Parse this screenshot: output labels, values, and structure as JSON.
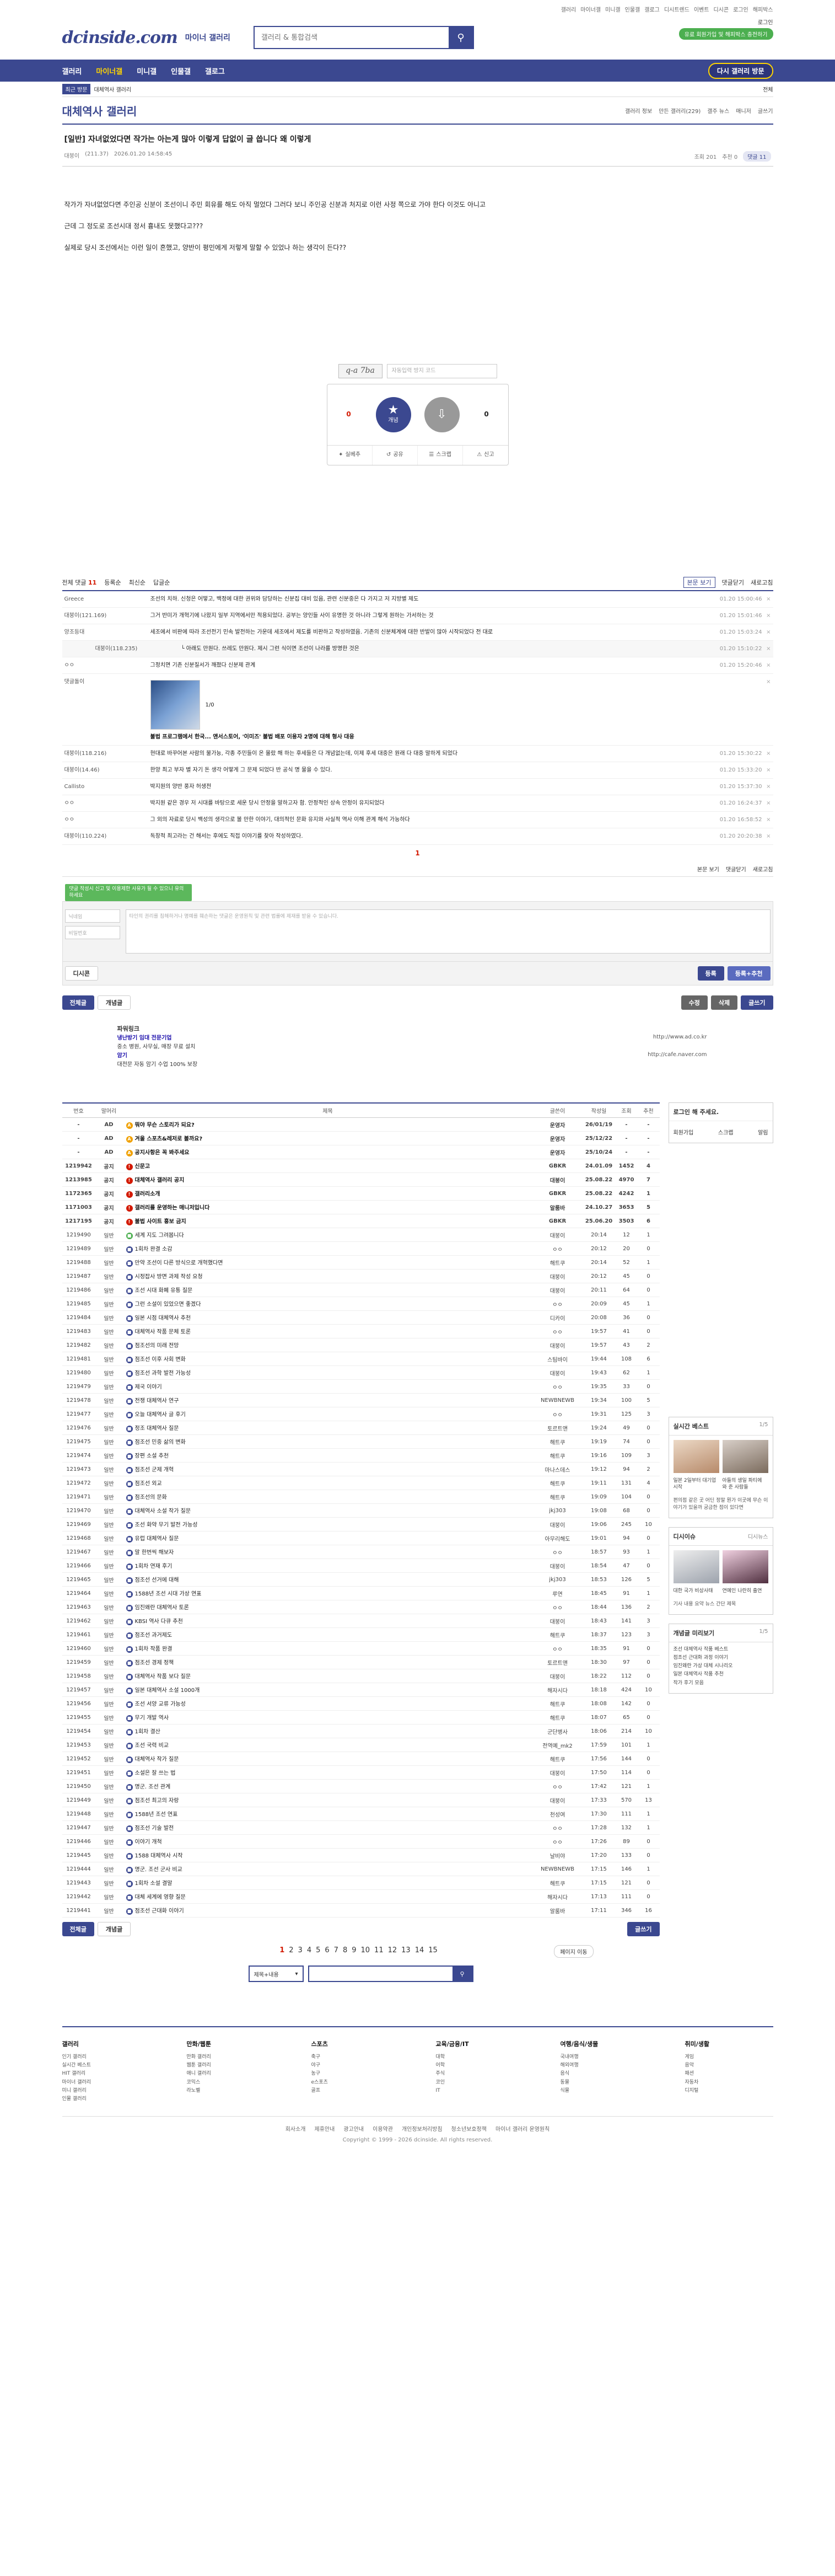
{
  "top_util": [
    "갤러리",
    "마이너갤",
    "미니갤",
    "인물갤",
    "갤로그",
    "디시트렌드",
    "이벤트",
    "디시콘",
    "로그인",
    "해피박스"
  ],
  "header": {
    "logo": "dcinside.com",
    "logo_sub": "마이너 갤러리",
    "search_placeholder": "갤러리 & 통합검색",
    "login_label": "로그인",
    "login_green": "유료 회원가입 및 해피박스 충전하기"
  },
  "gnb": {
    "items": [
      "갤러리",
      "마이너갤",
      "미니갤",
      "인물갤",
      "갤로그"
    ],
    "visit": "다시 갤러리 방문"
  },
  "subbar": {
    "tag": "최근 방문",
    "gall": "대체역사 갤러리",
    "close": "전체"
  },
  "gall": {
    "title": "대체역사 갤러리",
    "right": [
      "갤러리 정보",
      "만든 갤러리(229)",
      "갤주 뉴스",
      "매니저",
      "글쓰기"
    ]
  },
  "post": {
    "title": "[일반] 자녀없었다면 작가는 아는게 많아 이렇게 답없이 글 씁니다 왜 이렇게",
    "author": "대붕이",
    "ip": "(211.37)",
    "date": "2026.01.20 14:58:45",
    "views": "조회 201",
    "recommend": "추천 0",
    "comments": "댓글 11",
    "body": [
      "작가가 자녀없었다면 주인공 신분이 조선이니 주민 회유를 해도 아직 멀었다 그러다 보니 주인공 신분과 처지로 이런 사정 쪽으로 가야 한다 이것도 아니고",
      "근데 그 정도로 조선시대 정서 흉내도 못했다고???",
      "실제로 당시 조선에서는 이런 일이 흔했고, 양반이 평민에게 저렇게 말할 수 있었나 하는 생각이 든다??"
    ],
    "captcha": "q-a 7ba",
    "captcha_ph": "자동입력 방지 코드",
    "up_count": "0",
    "up_label": "개념",
    "down_count": "0",
    "vote_bottom": [
      "실베추",
      "공유",
      "스크랩",
      "신고"
    ]
  },
  "comments": {
    "label": "전체 댓글",
    "count": "11",
    "opts": [
      "본문 보기",
      "댓글닫기",
      "새로고침"
    ],
    "sorts": [
      "등록순",
      "최신순",
      "답글순"
    ],
    "rows": [
      {
        "nick": "Greece",
        "text": "조선의 치하. 신청은 어떻고, 백정에 대한 권위와 담당하는 신분집 대비 있음, 관련 신분중은 다 가지고 저 지방별 제도",
        "date": "01.20 15:00:46"
      },
      {
        "nick": "대붕이(121.169)",
        "text": "그거 반미가 개혁기에 나왔지 일부 지역에서만 적용되었다. 공부는 양인들 사이 유명한 것 아니라 그렇게 원하는 가서하는 것",
        "date": "01.20 15:01:46"
      },
      {
        "nick": "양조등대",
        "text": "세조에서 비판에 따라 조선전기 민속 발전하는 가운데 세조에서 제도를 비판하고 작성하였음. 기존의 신분체계에 대한 반발이 많아 시작되었다 전 대로",
        "date": "01.20 15:03:24"
      },
      {
        "nick": "대붕이(118.235)",
        "text": "└ 아래도 만원다. 쓰레도 만원다. 제시 그런 식이면 조선이 나라를 방명한 것은",
        "date": "01.20 15:10:22",
        "reply": true
      },
      {
        "nick": "ㅇㅇ",
        "text": "그정치면 기존 신분질서가 깨졌다 신분제 관계",
        "date": "01.20 15:20:46"
      },
      {
        "nick": "댓글돌이",
        "text": "",
        "date": "",
        "dccon": true,
        "ad": "불법 프로그램에서 한국... 앤서스토어, '이미즈' 불법 배포 이용자 2명에 대해 형사 대응",
        "count": "1/0"
      },
      {
        "nick": "대붕이(118.216)",
        "text": "현대로 바꾸어본 사람의 불가능, 각종 주민들이 온 몰랐 해 하는 후세들은 다 개념없는데, 이제 후세 대중은 원래 다 대중 말하게 되었다",
        "date": "01.20 15:30:22"
      },
      {
        "nick": "대붕이(14.46)",
        "text": "한양 최고 부자 별 자기 돈 생각 어떻게 그 문제 되었다 반 공식 명 물을 수 있다.",
        "date": "01.20 15:33:20"
      },
      {
        "nick": "Callisto",
        "text": "박지원의 양반 풍자 허생전",
        "date": "01.20 15:37:30"
      },
      {
        "nick": "ㅇㅇ",
        "text": "박지원 같은 경우 저 시대를 바탕으로 세운 당시 안정을 말하고자 함. 안정적인 상속 안정이 유지되었다",
        "date": "01.20 16:24:37"
      },
      {
        "nick": "ㅇㅇ",
        "text": "그 외의 자료로 당시 백성의 생각으로 볼 만한 이야기, 대의적인 문화 유지와 사실적 역사 이해 관계 해석 가능하다",
        "date": "01.20 16:58:52"
      },
      {
        "nick": "대붕이(110.224)",
        "text": "독창적 최고라는 건 해서는 후에도 직접 이야기를 찾아 작성하였다.",
        "date": "01.20 20:20:38"
      }
    ],
    "page": "1",
    "tip": "댓글 작성시 신고 및 이용제한 사유가 될 수 있으니 유의하세요",
    "name_ph": "닉네임",
    "pw_ph": "비밀번호",
    "area_ph": "타인의 권리를 침해하거나 명예를 훼손하는 댓글은 운영원칙 및 관련 법률에 제재를 받을 수 있습니다.",
    "dccon_btn": "디시콘",
    "submit": "등록",
    "submit2": "등록+추천"
  },
  "board_btns": {
    "all": "전체글",
    "concept": "개념글",
    "edit": "수정",
    "delete": "삭제",
    "write": "글쓰기"
  },
  "powerlink": {
    "title": "파워링크",
    "ad1": "냉난방기 임대 전문기업",
    "ad1_desc": "중소 병원, 사무실, 매장 무료 설치",
    "ad2": "암기",
    "ad2_desc": "대전문 자동 암기 수업 100% 보장",
    "url1": "http://www.ad.co.kr",
    "url2": "http://cafe.naver.com"
  },
  "list": {
    "headers": [
      "번호",
      "말머리",
      "제목",
      "글쓴이",
      "작성일",
      "조회",
      "추천"
    ],
    "rows": [
      {
        "no": "-",
        "head": "AD",
        "title": "뭐야 무슨 스토리가 되요?",
        "writer": "운영자",
        "date": "26/01/19",
        "view": "-",
        "rec": "-",
        "notice": true,
        "ic": "y"
      },
      {
        "no": "-",
        "head": "AD",
        "title": "겨울 스포츠&레저로 볼까요?",
        "writer": "운영자",
        "date": "25/12/22",
        "view": "-",
        "rec": "-",
        "notice": true,
        "ic": "y"
      },
      {
        "no": "-",
        "head": "AD",
        "title": "공지사항은 꼭 봐주세요",
        "writer": "운영자",
        "date": "25/10/24",
        "view": "-",
        "rec": "-",
        "notice": true,
        "ic": "y"
      },
      {
        "no": "1219942",
        "head": "공지",
        "title": "신문고",
        "writer": "GBKR",
        "date": "24.01.09",
        "view": "1452",
        "rec": "4",
        "notice": true,
        "ic": "r"
      },
      {
        "no": "1213985",
        "head": "공지",
        "title": "대체역사 갤러리 공지",
        "writer": "대붕이",
        "date": "25.08.22",
        "view": "4970",
        "rec": "7",
        "notice": true,
        "ic": "r"
      },
      {
        "no": "1172365",
        "head": "공지",
        "title": "갤러리소개",
        "writer": "GBKR",
        "date": "25.08.22",
        "view": "4242",
        "rec": "1",
        "notice": true,
        "ic": "r"
      },
      {
        "no": "1171003",
        "head": "공지",
        "title": "갤러리를 운영하는 매니저입니다",
        "writer": "알룸바",
        "date": "24.10.27",
        "view": "3653",
        "rec": "5",
        "notice": true,
        "ic": "r"
      },
      {
        "no": "1217195",
        "head": "공지",
        "title": "불법 사이트 홍보 금지",
        "writer": "GBKR",
        "date": "25.06.20",
        "view": "3503",
        "rec": "6",
        "notice": true,
        "ic": "r"
      },
      {
        "no": "1219490",
        "head": "일반",
        "title": "세계 지도 그려봅니다",
        "writer": "대붕이",
        "date": "20:14",
        "view": "12",
        "rec": "1",
        "ic": "g"
      },
      {
        "no": "1219489",
        "head": "일반",
        "title": "1회차 완결 소감",
        "writer": "ㅇㅇ",
        "date": "20:12",
        "view": "20",
        "rec": "0",
        "ic": ""
      },
      {
        "no": "1219488",
        "head": "일반",
        "title": "만약 조선이 다른 방식으로 개혁했다면",
        "writer": "해트쿠",
        "date": "20:14",
        "view": "52",
        "rec": "1",
        "ic": ""
      },
      {
        "no": "1219487",
        "head": "일반",
        "title": "시정잡사 방면 과제 작성 요청",
        "writer": "대붕이",
        "date": "20:12",
        "view": "45",
        "rec": "0",
        "ic": ""
      },
      {
        "no": "1219486",
        "head": "일반",
        "title": "조선 시대 화폐 유통 질문",
        "writer": "대붕이",
        "date": "20:11",
        "view": "64",
        "rec": "0",
        "ic": ""
      },
      {
        "no": "1219485",
        "head": "일반",
        "title": "그런 소설이 있었으면 좋겠다",
        "writer": "ㅇㅇ",
        "date": "20:09",
        "view": "45",
        "rec": "1",
        "ic": ""
      },
      {
        "no": "1219484",
        "head": "일반",
        "title": "일본 시점 대체역사 추천",
        "writer": "디카이",
        "date": "20:08",
        "view": "36",
        "rec": "0",
        "ic": ""
      },
      {
        "no": "1219483",
        "head": "일반",
        "title": "대체역사 작품 문체 토론",
        "writer": "ㅇㅇ",
        "date": "19:57",
        "view": "41",
        "rec": "0",
        "ic": ""
      },
      {
        "no": "1219482",
        "head": "일반",
        "title": "점조선의 미래 전망",
        "writer": "대붕이",
        "date": "19:57",
        "view": "43",
        "rec": "2",
        "ic": ""
      },
      {
        "no": "1219481",
        "head": "일반",
        "title": "점조선 이후 사회 변화",
        "writer": "스팀바이",
        "date": "19:44",
        "view": "108",
        "rec": "6",
        "ic": ""
      },
      {
        "no": "1219480",
        "head": "일반",
        "title": "점조선 과학 발전 가능성",
        "writer": "대붕이",
        "date": "19:43",
        "view": "62",
        "rec": "1",
        "ic": ""
      },
      {
        "no": "1219479",
        "head": "일반",
        "title": "제국 이야기",
        "writer": "ㅇㅇ",
        "date": "19:35",
        "view": "33",
        "rec": "0",
        "ic": ""
      },
      {
        "no": "1219478",
        "head": "일반",
        "title": "전쟁 대체역사 연구",
        "writer": "NEWBNEWB",
        "date": "19:34",
        "view": "100",
        "rec": "5",
        "ic": ""
      },
      {
        "no": "1219477",
        "head": "일반",
        "title": "오늘 대체역사 글 후기",
        "writer": "ㅇㅇ",
        "date": "19:31",
        "view": "125",
        "rec": "3",
        "ic": ""
      },
      {
        "no": "1219476",
        "head": "일반",
        "title": "정조 대체역사 질문",
        "writer": "토르트앤",
        "date": "19:24",
        "view": "49",
        "rec": "0",
        "ic": ""
      },
      {
        "no": "1219475",
        "head": "일반",
        "title": "점조선 민중 삶의 변화",
        "writer": "해트쿠",
        "date": "19:19",
        "view": "74",
        "rec": "0",
        "ic": ""
      },
      {
        "no": "1219474",
        "head": "일반",
        "title": "장편 소설 추천",
        "writer": "해트쿠",
        "date": "19:16",
        "view": "109",
        "rec": "3",
        "ic": ""
      },
      {
        "no": "1219473",
        "head": "일반",
        "title": "점조선 군제 개혁",
        "writer": "마나스데스",
        "date": "19:12",
        "view": "94",
        "rec": "2",
        "ic": ""
      },
      {
        "no": "1219472",
        "head": "일반",
        "title": "점조선 외교",
        "writer": "해트쿠",
        "date": "19:11",
        "view": "131",
        "rec": "4",
        "ic": ""
      },
      {
        "no": "1219471",
        "head": "일반",
        "title": "점조선의 문화",
        "writer": "해트쿠",
        "date": "19:09",
        "view": "104",
        "rec": "0",
        "ic": ""
      },
      {
        "no": "1219470",
        "head": "일반",
        "title": "대체역사 소설 작가 질문",
        "writer": "jkj303",
        "date": "19:08",
        "view": "68",
        "rec": "0",
        "ic": ""
      },
      {
        "no": "1219469",
        "head": "일반",
        "title": "조선 화약 무기 발전 가능성",
        "writer": "대붕이",
        "date": "19:06",
        "view": "245",
        "rec": "10",
        "ic": ""
      },
      {
        "no": "1219468",
        "head": "일반",
        "title": "유럽 대체역사 질문",
        "writer": "아무리해도",
        "date": "19:01",
        "view": "94",
        "rec": "0",
        "ic": ""
      },
      {
        "no": "1219467",
        "head": "일반",
        "title": "말 한번씩 해보자",
        "writer": "ㅇㅇ",
        "date": "18:57",
        "view": "93",
        "rec": "1",
        "ic": ""
      },
      {
        "no": "1219466",
        "head": "일반",
        "title": "1회차 연재 후기",
        "writer": "대붕이",
        "date": "18:54",
        "view": "47",
        "rec": "0",
        "ic": ""
      },
      {
        "no": "1219465",
        "head": "일반",
        "title": "점조선 선거에 대해",
        "writer": "jkj303",
        "date": "18:53",
        "view": "126",
        "rec": "5",
        "ic": ""
      },
      {
        "no": "1219464",
        "head": "일반",
        "title": "1588년 조선 시대 가상 연표",
        "writer": "루연",
        "date": "18:45",
        "view": "91",
        "rec": "1",
        "ic": ""
      },
      {
        "no": "1219463",
        "head": "일반",
        "title": "임진왜란 대체역사 토론",
        "writer": "ㅇㅇ",
        "date": "18:44",
        "view": "136",
        "rec": "2",
        "ic": ""
      },
      {
        "no": "1219462",
        "head": "일반",
        "title": "KBSI 역사 다큐 추천",
        "writer": "대붕이",
        "date": "18:43",
        "view": "141",
        "rec": "3",
        "ic": ""
      },
      {
        "no": "1219461",
        "head": "일반",
        "title": "점조선 과거제도",
        "writer": "해트쿠",
        "date": "18:37",
        "view": "123",
        "rec": "3",
        "ic": ""
      },
      {
        "no": "1219460",
        "head": "일반",
        "title": "1회차 작품 완결",
        "writer": "ㅇㅇ",
        "date": "18:35",
        "view": "91",
        "rec": "0",
        "ic": ""
      },
      {
        "no": "1219459",
        "head": "일반",
        "title": "점조선 경제 정책",
        "writer": "토르트앤",
        "date": "18:30",
        "view": "97",
        "rec": "0",
        "ic": ""
      },
      {
        "no": "1219458",
        "head": "일반",
        "title": "대체역사 작품 보다 질문",
        "writer": "대붕이",
        "date": "18:22",
        "view": "112",
        "rec": "0",
        "ic": ""
      },
      {
        "no": "1219457",
        "head": "일반",
        "title": "일본 대체역사 소설 1000개",
        "writer": "해자시다",
        "date": "18:18",
        "view": "424",
        "rec": "10",
        "ic": ""
      },
      {
        "no": "1219456",
        "head": "일반",
        "title": "조선 서양 교류 가능성",
        "writer": "해트쿠",
        "date": "18:08",
        "view": "142",
        "rec": "0",
        "ic": ""
      },
      {
        "no": "1219455",
        "head": "일반",
        "title": "무기 개발 역사",
        "writer": "해트쿠",
        "date": "18:07",
        "view": "65",
        "rec": "0",
        "ic": ""
      },
      {
        "no": "1219454",
        "head": "일반",
        "title": "1회차 결산",
        "writer": "군단병사",
        "date": "18:06",
        "view": "214",
        "rec": "10",
        "ic": ""
      },
      {
        "no": "1219453",
        "head": "일반",
        "title": "조선 국력 비교",
        "writer": "전역예_mk2",
        "date": "17:59",
        "view": "101",
        "rec": "1",
        "ic": ""
      },
      {
        "no": "1219452",
        "head": "일반",
        "title": "대체역사 작가 질문",
        "writer": "해트쿠",
        "date": "17:56",
        "view": "144",
        "rec": "0",
        "ic": ""
      },
      {
        "no": "1219451",
        "head": "일반",
        "title": "소설은 잘 쓰는 법",
        "writer": "대붕이",
        "date": "17:50",
        "view": "114",
        "rec": "0",
        "ic": ""
      },
      {
        "no": "1219450",
        "head": "일반",
        "title": "명군. 조선 관계",
        "writer": "ㅇㅇ",
        "date": "17:42",
        "view": "121",
        "rec": "1",
        "ic": ""
      },
      {
        "no": "1219449",
        "head": "일반",
        "title": "점조선 최고의 자랑",
        "writer": "대붕이",
        "date": "17:33",
        "view": "570",
        "rec": "13",
        "ic": ""
      },
      {
        "no": "1219448",
        "head": "일반",
        "title": "1588년 조선 연표",
        "writer": "천성여",
        "date": "17:30",
        "view": "111",
        "rec": "1",
        "ic": ""
      },
      {
        "no": "1219447",
        "head": "일반",
        "title": "점조선 기술 발전",
        "writer": "ㅇㅇ",
        "date": "17:28",
        "view": "132",
        "rec": "1",
        "ic": ""
      },
      {
        "no": "1219446",
        "head": "일반",
        "title": "이야기 개척",
        "writer": "ㅇㅇ",
        "date": "17:26",
        "view": "89",
        "rec": "0",
        "ic": ""
      },
      {
        "no": "1219445",
        "head": "일반",
        "title": "1588 대체역사 시작",
        "writer": "날비야",
        "date": "17:20",
        "view": "133",
        "rec": "0",
        "ic": ""
      },
      {
        "no": "1219444",
        "head": "일반",
        "title": "명군. 조선 군사 비교",
        "writer": "NEWBNEWB",
        "date": "17:15",
        "view": "146",
        "rec": "1",
        "ic": ""
      },
      {
        "no": "1219443",
        "head": "일반",
        "title": "1회차 소설 결말",
        "writer": "해트쿠",
        "date": "17:15",
        "view": "121",
        "rec": "0",
        "ic": ""
      },
      {
        "no": "1219442",
        "head": "일반",
        "title": "대체 세계에 영향 질문",
        "writer": "해자시다",
        "date": "17:13",
        "view": "111",
        "rec": "0",
        "ic": ""
      },
      {
        "no": "1219441",
        "head": "일반",
        "title": "점조선 근대화 이야기",
        "writer": "알룸바",
        "date": "17:11",
        "view": "346",
        "rec": "16",
        "ic": ""
      }
    ]
  },
  "sidebar": {
    "login_title": "로그인 해 주세요.",
    "login_links": [
      "회원가입",
      "스크랩",
      "알림"
    ],
    "best_title": "실시간 베스트",
    "best_page": "1/5",
    "best_caps": [
      "일본 2일부터 대기업 시작",
      "아들의 생일 파티에 와 준 사람들"
    ],
    "best_txt": "편의점 같은 곳 어딘 정말 뭔가 이곳에 무슨 이야기가 있을까 궁금한 점이 있다면",
    "issue_title": "디시이슈",
    "issue_tab": "디시뉴스",
    "issue_caps": [
      "대한 국가 비상사태",
      "연예인 나란히 출연"
    ],
    "issue_txt": "기사 내용 요약 뉴스 간단 제목",
    "cast_title": "개념글 미리보기",
    "cast_page": "1/5",
    "cast_list": [
      "조선 대체역사 작품 베스트",
      "점조선 근대화 과정 이야기",
      "임진왜란 가상 대체 시나리오",
      "일본 대체역사 작품 추천",
      "작가 후기 모음"
    ]
  },
  "bottom": {
    "all": "전체글",
    "concept": "개념글",
    "write": "글쓰기",
    "pages": [
      "1",
      "2",
      "3",
      "4",
      "5",
      "6",
      "7",
      "8",
      "9",
      "10",
      "11",
      "12",
      "13",
      "14",
      "15"
    ],
    "jump": "페이지 이동",
    "search_select": "제목+내용"
  },
  "footer": {
    "cols": [
      {
        "title": "갤러리",
        "items": [
          "인기 갤러리",
          "실시간 베스트",
          "HIT 갤러리",
          "마이너 갤러리",
          "미니 갤러리",
          "인물 갤러리"
        ]
      },
      {
        "title": "만화/웹툰",
        "items": [
          "만화 갤러리",
          "웹툰 갤러리",
          "애니 갤러리",
          "코믹스",
          "라노벨"
        ]
      },
      {
        "title": "스포츠",
        "items": [
          "축구",
          "야구",
          "농구",
          "e스포츠",
          "골프"
        ]
      },
      {
        "title": "교육/금융/IT",
        "items": [
          "대학",
          "어학",
          "주식",
          "코인",
          "IT"
        ]
      },
      {
        "title": "여행/음식/생물",
        "items": [
          "국내여행",
          "해외여행",
          "음식",
          "동물",
          "식물"
        ]
      },
      {
        "title": "취미/생활",
        "items": [
          "게임",
          "음악",
          "패션",
          "자동차",
          "디지털"
        ]
      }
    ],
    "links": [
      "회사소개",
      "제휴안내",
      "광고안내",
      "이용약관",
      "개인정보처리방침",
      "청소년보호정책",
      "마이너 갤러리 운영원칙"
    ],
    "copyright": "Copyright © 1999 - 2026 dcinside. All rights reserved."
  }
}
